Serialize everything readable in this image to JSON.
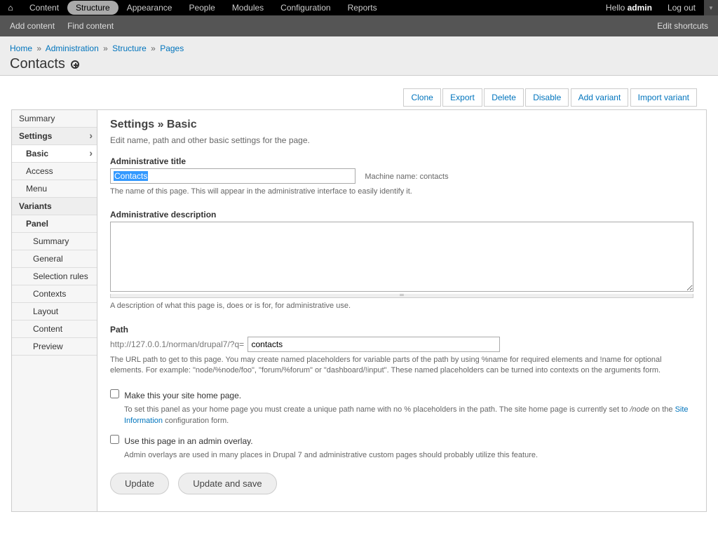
{
  "toolbar": {
    "items": [
      "Content",
      "Structure",
      "Appearance",
      "People",
      "Modules",
      "Configuration",
      "Reports"
    ],
    "active_index": 1,
    "hello_prefix": "Hello ",
    "hello_user": "admin",
    "logout": "Log out"
  },
  "shortcuts": {
    "add": "Add content",
    "find": "Find content",
    "edit": "Edit shortcuts"
  },
  "breadcrumb": {
    "items": [
      "Home",
      "Administration",
      "Structure",
      "Pages"
    ]
  },
  "page_title": "Contacts",
  "action_tabs": [
    "Clone",
    "Export",
    "Delete",
    "Disable",
    "Add variant",
    "Import variant"
  ],
  "sidebar": {
    "summary": "Summary",
    "settings": "Settings",
    "basic": "Basic",
    "access": "Access",
    "menu": "Menu",
    "variants": "Variants",
    "panel": "Panel",
    "panel_items": [
      "Summary",
      "General",
      "Selection rules",
      "Contexts",
      "Layout",
      "Content",
      "Preview"
    ]
  },
  "content": {
    "section_title": "Settings » Basic",
    "intro": "Edit name, path and other basic settings for the page.",
    "admin_title_label": "Administrative title",
    "admin_title_value": "Contacts",
    "machine_name_label": "Machine name: ",
    "machine_name_value": "contacts",
    "admin_title_help": "The name of this page. This will appear in the administrative interface to easily identify it.",
    "admin_desc_label": "Administrative description",
    "admin_desc_value": "",
    "admin_desc_help": "A description of what this page is, does or is for, for administrative use.",
    "path_label": "Path",
    "path_prefix": "http://127.0.0.1/norman/drupal7/?q=",
    "path_value": "contacts",
    "path_help": "The URL path to get to this page. You may create named placeholders for variable parts of the path by using %name for required elements and !name for optional elements. For example: \"node/%node/foo\", \"forum/%forum\" or \"dashboard/!input\". These named placeholders can be turned into contexts on the arguments form.",
    "homepage_checkbox": "Make this your site home page.",
    "homepage_help_pre": "To set this panel as your home page you must create a unique path name with no % placeholders in the path. The site home page is currently set to ",
    "homepage_help_node": "/node",
    "homepage_help_mid": " on the ",
    "homepage_help_link": "Site Information",
    "homepage_help_post": " configuration form.",
    "overlay_checkbox": "Use this page in an admin overlay.",
    "overlay_help": "Admin overlays are used in many places in Drupal 7 and administrative custom pages should probably utilize this feature.",
    "btn_update": "Update",
    "btn_update_save": "Update and save"
  }
}
